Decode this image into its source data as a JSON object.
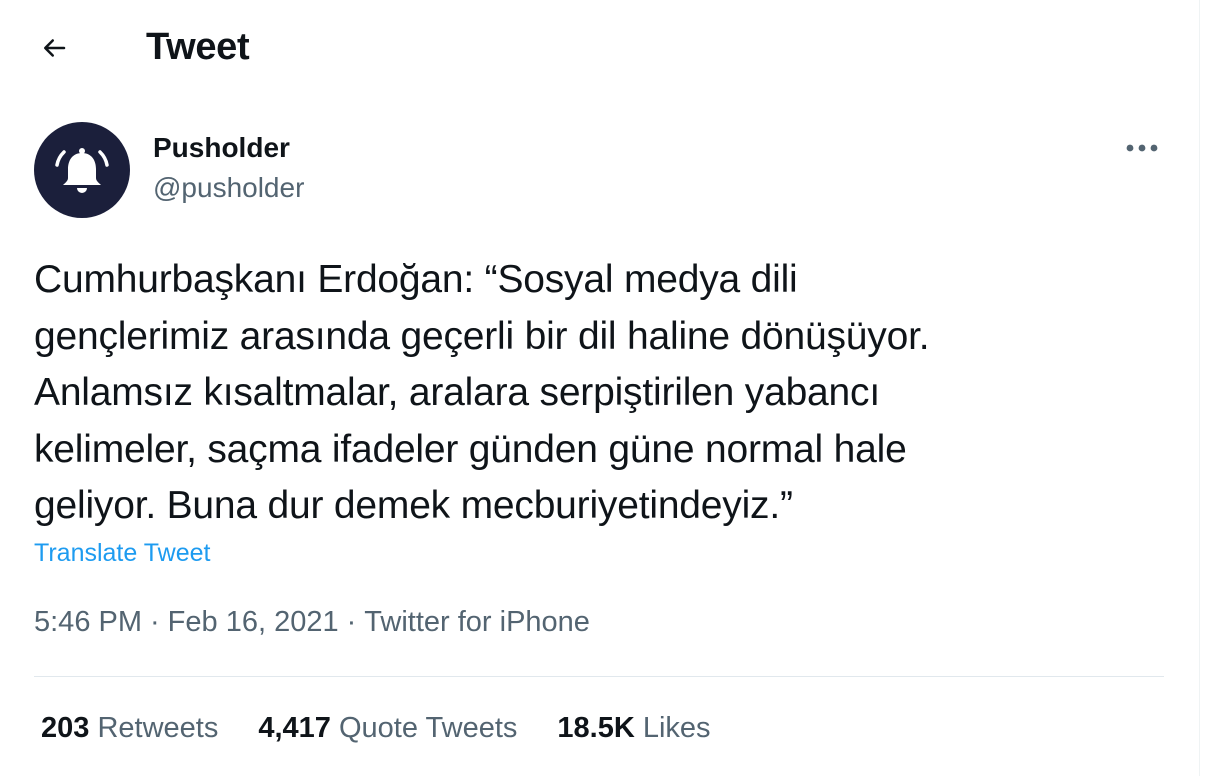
{
  "header": {
    "back_icon": "arrow-left-icon",
    "title": "Tweet"
  },
  "author": {
    "avatar_icon": "bell-icon",
    "avatar_color": "#1b1f3b",
    "display_name": "Pusholder",
    "handle": "@pusholder"
  },
  "more_icon": "ellipsis-icon",
  "tweet": {
    "lines": [
      "Cumhurbaşkanı Erdoğan: “Sosyal medya dili",
      "gençlerimiz arasında geçerli bir dil haline dönüşüyor.",
      "Anlamsız kısaltmalar, aralara serpiştirilen yabancı",
      "kelimeler, saçma ifadeler günden güne normal hale",
      "geliyor. Buna dur demek mecburiyetindeyiz.”"
    ],
    "translate_label": "Translate Tweet"
  },
  "meta": {
    "time": "5:46 PM",
    "date": "Feb 16, 2021",
    "source": "Twitter for iPhone",
    "separator": "·"
  },
  "stats": {
    "retweets": {
      "count": "203",
      "label": "Retweets"
    },
    "quotes": {
      "count": "4,417",
      "label": "Quote Tweets"
    },
    "likes": {
      "count": "18.5K",
      "label": "Likes"
    }
  },
  "colors": {
    "accent": "#1d9bf0",
    "secondary_text": "#536471",
    "primary_text": "#0f1419"
  }
}
